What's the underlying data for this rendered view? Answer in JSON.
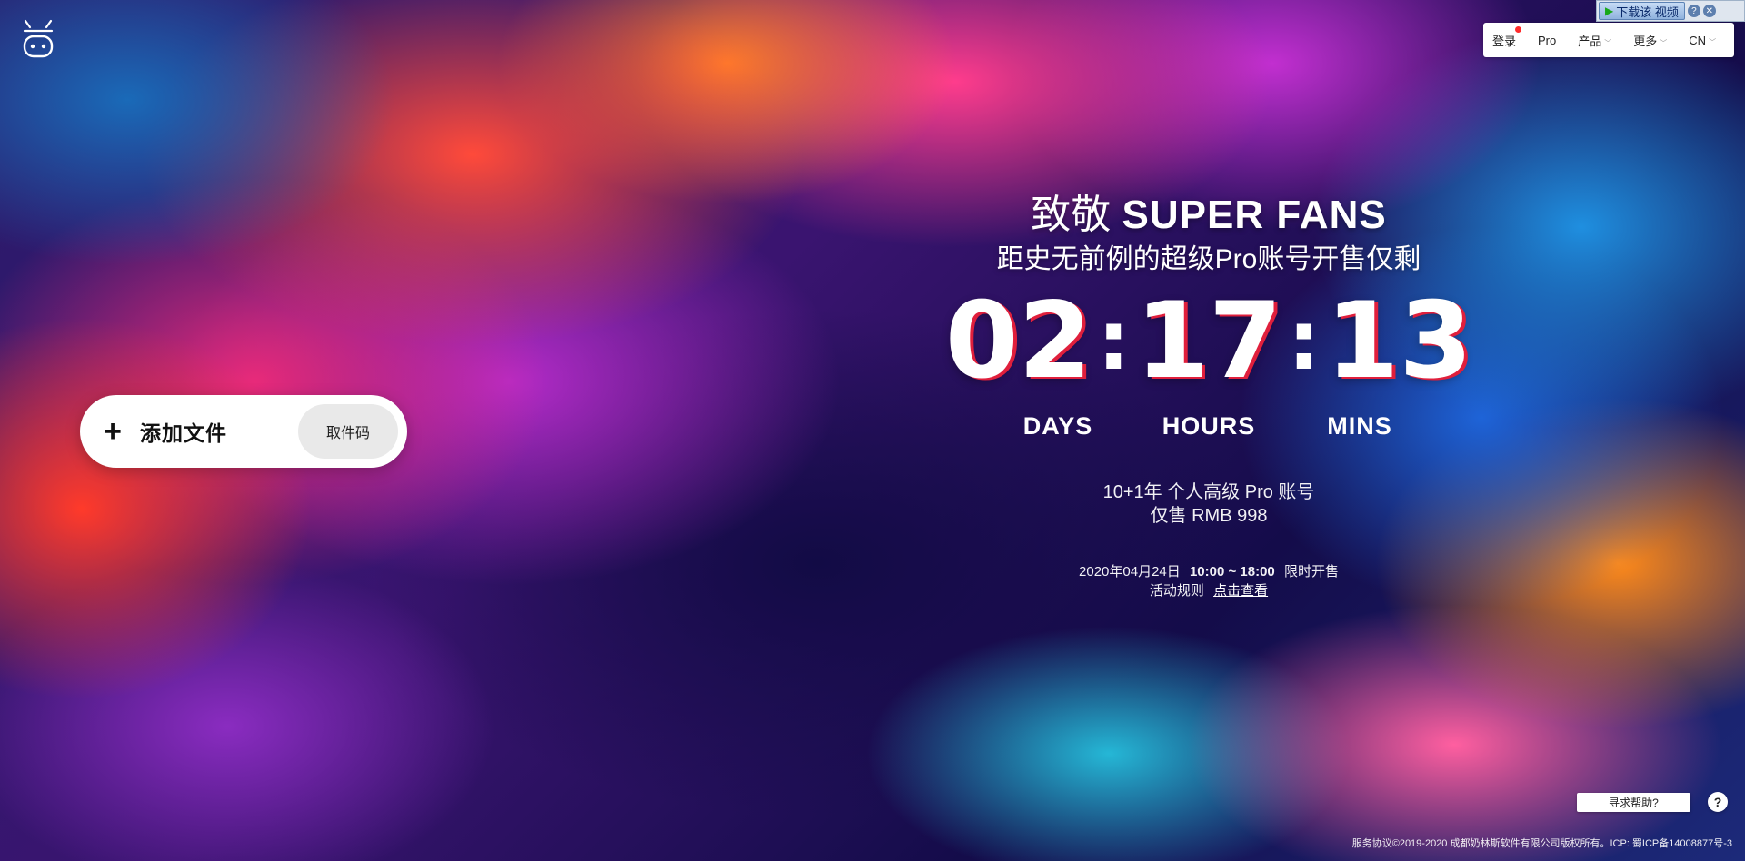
{
  "header": {
    "nav": {
      "login": "登录",
      "pro": "Pro",
      "products": "产品",
      "more": "更多",
      "lang": "CN"
    }
  },
  "downloader": {
    "label": "下载该 视频",
    "help": "?",
    "close": "✕"
  },
  "upload": {
    "plus": "+",
    "add_label": "添加文件",
    "code_button": "取件码"
  },
  "promo": {
    "headline_prefix": "致敬",
    "headline_strong": "SUPER FANS",
    "subline": "距史无前例的超级Pro账号开售仅剩",
    "countdown": {
      "days": "02",
      "hours": "17",
      "mins": "13",
      "separator": ":"
    },
    "units": {
      "days": "DAYS",
      "hours": "HOURS",
      "mins": "MINS"
    },
    "offer_line1": "10+1年 个人高级 Pro 账号",
    "offer_line2": "仅售 RMB 998",
    "schedule_date": "2020年04月24日",
    "schedule_time": "10:00 ~ 18:00",
    "schedule_note": "限时开售",
    "rules_label": "活动规则",
    "rules_link": "点击查看"
  },
  "help": {
    "button": "寻求帮助?",
    "icon": "?"
  },
  "footer": {
    "text": "服务协议©2019-2020 成都奶林斯软件有限公司版权所有。ICP: 蜀ICP备14008877号-3"
  },
  "colors": {
    "accent_red": "#e01f3c",
    "notification_dot": "#ff2b2b"
  }
}
